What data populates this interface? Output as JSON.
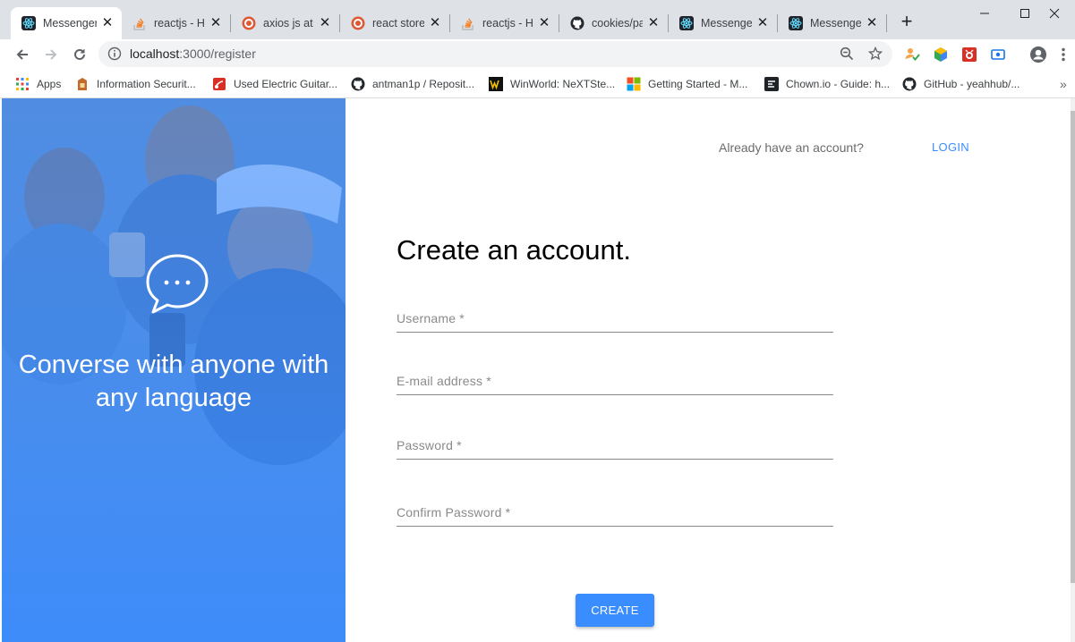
{
  "browser": {
    "tabs": [
      {
        "title": "Messenger",
        "icon": "react-icon",
        "active": true
      },
      {
        "title": "reactjs - Ho",
        "icon": "stackoverflow-icon",
        "active": false
      },
      {
        "title": "axios js at l",
        "icon": "duckduckgo-icon",
        "active": false
      },
      {
        "title": "react store",
        "icon": "duckduckgo-icon",
        "active": false
      },
      {
        "title": "reactjs - Ho",
        "icon": "stackoverflow-icon",
        "active": false
      },
      {
        "title": "cookies/pa",
        "icon": "github-icon",
        "active": false
      },
      {
        "title": "Messenger",
        "icon": "react-icon",
        "active": false
      },
      {
        "title": "Messenger",
        "icon": "react-icon",
        "active": false
      }
    ],
    "address": {
      "host": "localhost",
      "path": ":3000/register"
    },
    "bookmarks": [
      {
        "label": "Apps",
        "icon": "apps-grid-icon"
      },
      {
        "label": "Information Securit...",
        "icon": "bookmark-page-icon"
      },
      {
        "label": "Used Electric Guitar...",
        "icon": "guitar-site-icon"
      },
      {
        "label": "antman1p / Reposit...",
        "icon": "github-icon"
      },
      {
        "label": "WinWorld: NeXTSte...",
        "icon": "winworld-icon"
      },
      {
        "label": "Getting Started - M...",
        "icon": "microsoft-icon"
      },
      {
        "label": "Chown.io - Guide: h...",
        "icon": "chown-icon"
      },
      {
        "label": "GitHub - yeahhub/...",
        "icon": "github-icon"
      }
    ],
    "colors": {
      "tabstrip": "#dee1e6",
      "omnibox": "#f1f3f4"
    }
  },
  "page": {
    "hero": {
      "tagline": "Converse with anyone with any language",
      "icon": "chat-bubble-icon"
    },
    "header": {
      "prompt": "Already have an account?",
      "login_label": "LOGIN"
    },
    "form": {
      "title": "Create an account.",
      "fields": {
        "username": "Username *",
        "email": "E-mail address *",
        "password": "Password *",
        "confirm_password": "Confirm Password *"
      },
      "submit_label": "CREATE"
    },
    "colors": {
      "accent": "#3a8dff",
      "hero_gradient_top": "#5d8fd4",
      "hero_gradient_bottom": "#3f8cf8"
    }
  }
}
